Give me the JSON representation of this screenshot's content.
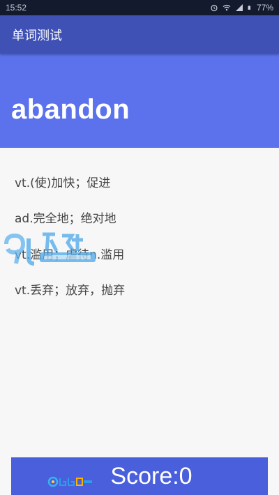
{
  "status_bar": {
    "time": "15:52",
    "battery": "77%",
    "icons": [
      "alarm-icon",
      "wifi-icon",
      "signal-icon",
      "battery-icon"
    ]
  },
  "app_bar": {
    "title": "单词测试"
  },
  "word": {
    "text": "abandon"
  },
  "options": [
    {
      "label": "vt.(使)加快；促进"
    },
    {
      "label": "ad.完全地；绝对地"
    },
    {
      "label": "vt.滥用；虐待n.滥用"
    },
    {
      "label": "vt.丢弃；放弃，抛弃"
    }
  ],
  "score": {
    "label": "Score:0"
  },
  "colors": {
    "status_bar": "#141a2e",
    "app_bar": "#3f51b5",
    "word_panel": "#5b72ec",
    "score_bar": "#4a5fdc",
    "option_text": "#444444"
  }
}
